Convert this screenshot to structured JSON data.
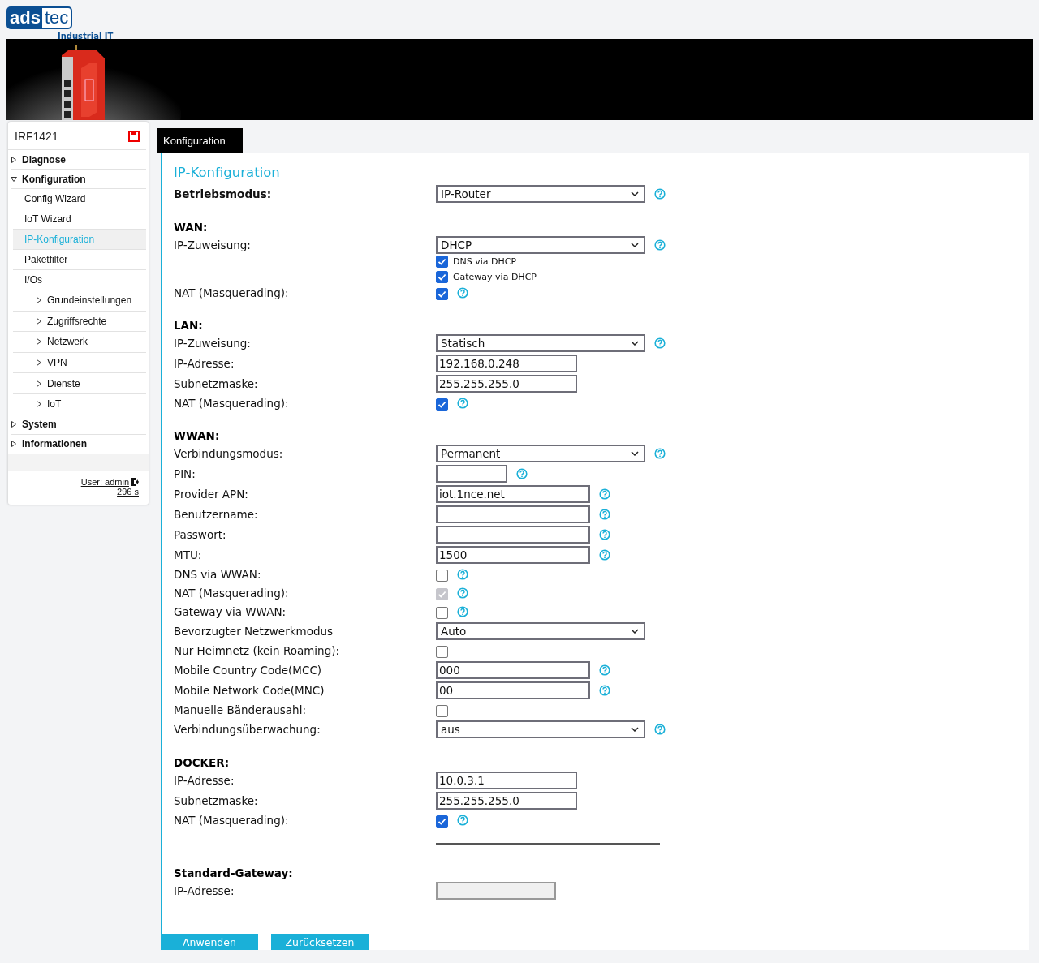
{
  "logo": {
    "left": "ads",
    "right": "tec",
    "tagline": "Industrial IT"
  },
  "banner": {
    "kind": "picture"
  },
  "sidebar": {
    "device": "IRF1421",
    "items": [
      {
        "label": "Diagnose",
        "expanded": false,
        "selected": false
      },
      {
        "label": "Konfiguration",
        "expanded": true,
        "selected": false,
        "children": [
          {
            "label": "Config Wizard",
            "selected": false
          },
          {
            "label": "IoT Wizard",
            "selected": false
          },
          {
            "label": "IP-Konfiguration",
            "selected": true
          },
          {
            "label": "Paketfilter",
            "selected": false
          },
          {
            "label": "I/Os",
            "selected": false,
            "children": [
              {
                "label": "Grundeinstellungen",
                "expanded": false,
                "selected": false
              },
              {
                "label": "Zugriffsrechte",
                "expanded": false,
                "selected": false
              },
              {
                "label": "Netzwerk",
                "expanded": false,
                "selected": false
              },
              {
                "label": "VPN",
                "expanded": false,
                "selected": false
              },
              {
                "label": "Dienste",
                "expanded": false,
                "selected": false
              },
              {
                "label": "IoT",
                "expanded": false,
                "selected": false
              }
            ]
          }
        ]
      },
      {
        "label": "System",
        "expanded": false,
        "selected": false
      },
      {
        "label": "Informationen",
        "expanded": false,
        "selected": false
      }
    ],
    "user": "User: admin",
    "timer": "296 s"
  },
  "tabs": [
    {
      "label": "Konfiguration",
      "selected": true
    }
  ],
  "form": {
    "title": "IP-Konfiguration",
    "sections": [
      {
        "rows": [
          {
            "kind": "select",
            "label": "Betriebsmodus:",
            "bold": true,
            "value": "IP-Router",
            "help": true
          }
        ]
      },
      {
        "heading": "WAN:",
        "rows": [
          {
            "kind": "select",
            "label": "IP-Zuweisung:",
            "value": "DHCP",
            "help": true
          },
          {
            "kind": "checkbox_group",
            "options": [
              {
                "label": "DNS via DHCP",
                "checked": true
              },
              {
                "label": "Gateway via DHCP",
                "checked": true
              }
            ]
          },
          {
            "kind": "checkbox",
            "label": "NAT (Masquerading):",
            "checked": true,
            "disabled": false,
            "help": true
          }
        ]
      },
      {
        "heading": "LAN:",
        "rows": [
          {
            "kind": "select",
            "label": "IP-Zuweisung:",
            "value": "Statisch",
            "help": true
          },
          {
            "kind": "address",
            "label": "IP-Adresse:",
            "value": "192.168.0.248",
            "help": false
          },
          {
            "kind": "address",
            "label": "Subnetzmaske:",
            "value": "255.255.255.0",
            "help": false
          },
          {
            "kind": "checkbox",
            "label": "NAT (Masquerading):",
            "checked": true,
            "disabled": false,
            "help": true
          }
        ]
      },
      {
        "heading": "WWAN:",
        "rows": [
          {
            "kind": "select",
            "label": "Verbindungsmodus:",
            "value": "Permanent",
            "help": true
          },
          {
            "kind": "pin",
            "label": "PIN:",
            "value": "",
            "help": true
          },
          {
            "kind": "text",
            "label": "Provider APN:",
            "value": "iot.1nce.net",
            "help": true
          },
          {
            "kind": "text",
            "label": "Benutzername:",
            "value": "",
            "help": true
          },
          {
            "kind": "text",
            "label": "Passwort:",
            "value": "",
            "help": true
          },
          {
            "kind": "text",
            "label": "MTU:",
            "value": "1500",
            "help": true
          },
          {
            "kind": "checkbox",
            "label": "DNS via WWAN:",
            "checked": false,
            "disabled": false,
            "help": true
          },
          {
            "kind": "checkbox",
            "label": "NAT (Masquerading):",
            "checked": true,
            "disabled": true,
            "help": true
          },
          {
            "kind": "checkbox",
            "label": "Gateway via WWAN:",
            "checked": false,
            "disabled": false,
            "help": true
          },
          {
            "kind": "select",
            "label": "Bevorzugter Netzwerkmodus",
            "value": "Auto",
            "help": false
          },
          {
            "kind": "checkbox",
            "label": "Nur Heimnetz (kein Roaming):",
            "checked": false,
            "disabled": false,
            "help": false
          },
          {
            "kind": "text",
            "label": "Mobile Country Code(MCC)",
            "value": "000",
            "help": true
          },
          {
            "kind": "text",
            "label": "Mobile Network Code(MNC)",
            "value": "00",
            "help": true
          },
          {
            "kind": "checkbox",
            "label": "Manuelle Bänderausahl:",
            "checked": false,
            "disabled": false,
            "help": false
          },
          {
            "kind": "select",
            "label": "Verbindungsüberwachung:",
            "value": "aus",
            "help": true
          }
        ]
      },
      {
        "heading": "DOCKER:",
        "rows": [
          {
            "kind": "address",
            "label": "IP-Adresse:",
            "value": "10.0.3.1",
            "help": false
          },
          {
            "kind": "address",
            "label": "Subnetzmaske:",
            "value": "255.255.255.0",
            "help": false
          },
          {
            "kind": "checkbox",
            "label": "NAT (Masquerading):",
            "checked": true,
            "disabled": false,
            "help": true
          },
          {
            "kind": "rule"
          }
        ]
      },
      {
        "heading": "Standard-Gateway:",
        "rows": [
          {
            "kind": "gateway",
            "label": "IP-Adresse:",
            "value": "",
            "disabled": true,
            "help": false
          }
        ]
      }
    ]
  },
  "buttons": [
    "Anwenden",
    "Zurücksetzen"
  ]
}
